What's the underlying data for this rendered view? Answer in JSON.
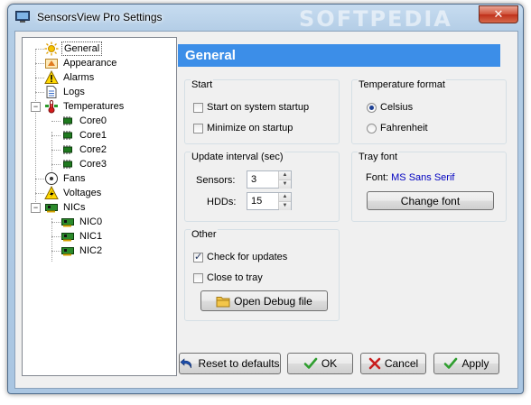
{
  "window": {
    "title": "SensorsView Pro Settings",
    "watermark": "SOFTPEDIA",
    "close_glyph": "✕"
  },
  "tree": {
    "items": [
      {
        "label": "General",
        "icon": "sun-icon",
        "selected": true
      },
      {
        "label": "Appearance",
        "icon": "appearance-icon"
      },
      {
        "label": "Alarms",
        "icon": "warning-icon"
      },
      {
        "label": "Logs",
        "icon": "document-icon"
      },
      {
        "label": "Temperatures",
        "icon": "thermometer-icon"
      },
      {
        "label": "Core0",
        "icon": "chip-icon"
      },
      {
        "label": "Core1",
        "icon": "chip-icon"
      },
      {
        "label": "Core2",
        "icon": "chip-icon"
      },
      {
        "label": "Core3",
        "icon": "chip-icon"
      },
      {
        "label": "Fans",
        "icon": "fan-icon"
      },
      {
        "label": "Voltages",
        "icon": "voltage-icon"
      },
      {
        "label": "NICs",
        "icon": "network-card-icon"
      },
      {
        "label": "NIC0",
        "icon": "network-card-icon"
      },
      {
        "label": "NIC1",
        "icon": "network-card-icon"
      },
      {
        "label": "NIC2",
        "icon": "network-card-icon"
      }
    ]
  },
  "header": {
    "title": "General"
  },
  "start": {
    "title": "Start",
    "startup_label": "Start on system startup",
    "startup_checked": false,
    "minimize_label": "Minimize on startup",
    "minimize_checked": false
  },
  "update": {
    "title": "Update interval (sec)",
    "sensors_label": "Sensors:",
    "sensors_value": "3",
    "hdds_label": "HDDs:",
    "hdds_value": "15"
  },
  "other": {
    "title": "Other",
    "check_updates_label": "Check for updates",
    "check_updates_checked": true,
    "close_tray_label": "Close to tray",
    "close_tray_checked": false,
    "debug_button": "Open Debug file"
  },
  "temperature": {
    "title": "Temperature format",
    "celsius_label": "Celsius",
    "fahrenheit_label": "Fahrenheit",
    "selected": "Celsius"
  },
  "tray_font": {
    "title": "Tray font",
    "font_label": "Font:",
    "font_value": "MS Sans Serif",
    "change_button": "Change font"
  },
  "footer": {
    "reset": "Reset to defaults",
    "ok": "OK",
    "cancel": "Cancel",
    "apply": "Apply"
  },
  "colors": {
    "header_bg": "#3c8ee8",
    "font_value": "#0000c0",
    "ok_check": "#2f9e2f",
    "cancel_x": "#c81e1e"
  }
}
